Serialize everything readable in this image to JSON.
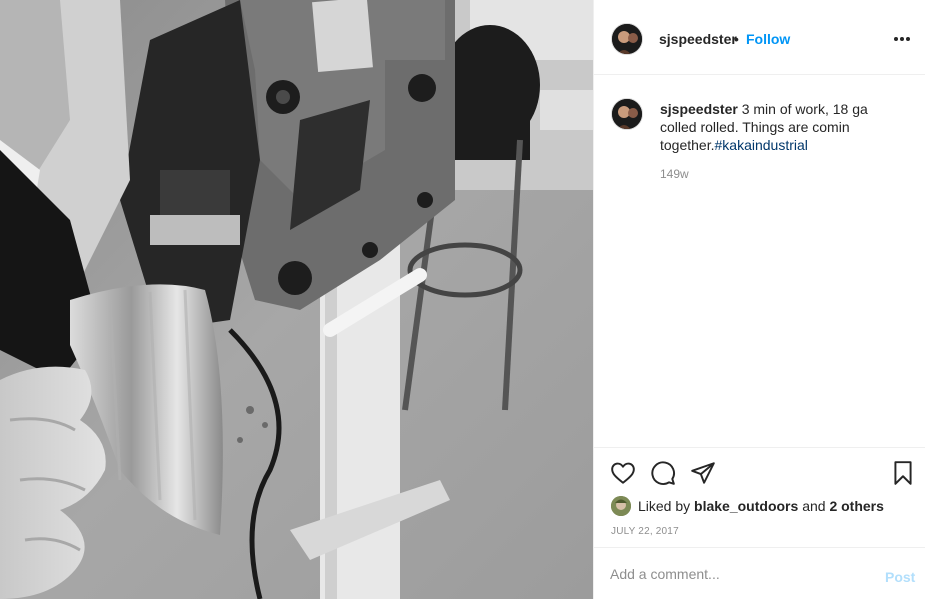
{
  "post": {
    "image_alt": "Black and white photo of a hand holding a metal panel in front of an english wheel machine",
    "username": "sjspeedster",
    "follow_label": "Follow",
    "dot": "•"
  },
  "caption": {
    "username": "sjspeedster",
    "text": " 3 min of work, 18 ga colled rolled. Things are comin together.",
    "hashtag": "#kakaindustrial",
    "time_ago": "149w"
  },
  "actions": {
    "like_icon": "heart-icon",
    "comment_icon": "comment-icon",
    "share_icon": "paper-plane-icon",
    "save_icon": "bookmark-icon"
  },
  "likes": {
    "prefix": "Liked by ",
    "user": "blake_outdoors",
    "middle": " and ",
    "others": "2 others"
  },
  "date": "JULY 22, 2017",
  "comment": {
    "placeholder": "Add a comment...",
    "post_label": "Post"
  },
  "colors": {
    "accent": "#0095f6",
    "hashtag": "#00376b",
    "muted": "#8e8e8e",
    "post_disabled": "#b2dffc"
  }
}
